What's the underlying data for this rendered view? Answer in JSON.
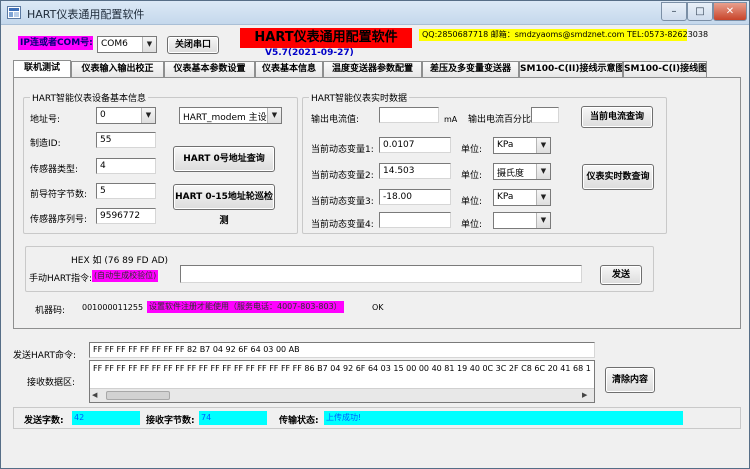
{
  "window": {
    "title": "HART仪表通用配置软件",
    "controls": [
      "–",
      "□",
      "✕"
    ]
  },
  "header": {
    "ip_com_label": "IP连或者COM号:",
    "com_port": "COM6",
    "close_port_button": "关闭串口",
    "app_title": "HART仪表通用配置软件",
    "version": "V5.7(2021-09-27)",
    "contact": "QQ:2850687718  邮箱：smdzyaoms@smdznet.com TEL:0573-82623038"
  },
  "tabs": [
    {
      "label": "联机测试",
      "active": true
    },
    {
      "label": "仪表输入输出校正",
      "active": false
    },
    {
      "label": "仪表基本参数设置",
      "active": false
    },
    {
      "label": "仪表基本信息",
      "active": false
    },
    {
      "label": "温度变送器参数配置",
      "active": false
    },
    {
      "label": "差压及多变量变送器",
      "active": false
    },
    {
      "label": "SM100-C(II)接线示意图",
      "active": false
    },
    {
      "label": "SM100-C(I)接线图)",
      "active": false
    }
  ],
  "device_info": {
    "group_title": "HART智能仪表设备基本信息",
    "address_label": "地址号:",
    "address_value": "0",
    "modem_select": "HART_modem 主设备Ⅱ",
    "manufacturer_label": "制造ID:",
    "manufacturer_value": "55",
    "sensor_type_label": "传感器类型:",
    "sensor_type_value": "4",
    "preamble_label": "前导符字节数:",
    "preamble_value": "5",
    "serial_label": "传感器序列号:",
    "serial_value": "9596772",
    "query_addr0_button": "HART 0号地址查询",
    "poll_button": "HART 0-15地址轮巡检测"
  },
  "realtime": {
    "group_title": "HART智能仪表实时数据",
    "current_label": "输出电流值:",
    "current_value": "",
    "current_unit": "mA",
    "percent_label": "输出电流百分比:",
    "percent_value": "",
    "query_current_button": "当前电流查询",
    "query_realtime_button": "仪表实时数查询",
    "unit_label": "单位:",
    "variables": [
      {
        "label": "当前动态变量1:",
        "value": "0.0107",
        "unit": "KPa"
      },
      {
        "label": "当前动态变量2:",
        "value": "14.503",
        "unit": "摄氏度"
      },
      {
        "label": "当前动态变量3:",
        "value": "-18.00",
        "unit": "KPa"
      },
      {
        "label": "当前动态变量4:",
        "value": "",
        "unit": ""
      }
    ]
  },
  "manual": {
    "hex_hint": "HEX 如 (76 89 FD AD)",
    "command_label": "手动HART指令:",
    "auto_checksum": "(自动生成校验位)",
    "command_value": "",
    "send_button": "发送"
  },
  "machine": {
    "label": "机器码:",
    "code": "001000011255",
    "register_note": "设置软件注册才能使用（服务电话：4007-803-803）",
    "ok": "OK"
  },
  "comm": {
    "send_label": "发送HART命令:",
    "send_value": "FF FF FF FF FF FF FF FF 82 B7 04 92 6F 64 03 00 AB",
    "recv_label": "接收数据区:",
    "recv_value": "FF FF FF FF FF FF FF FF FF FF FF FF FF FF FF FF FF FF 86 B7 04 92 6F 64 03 15 00 00 40 81 19 40 0C 3C 2F C8 6C 20 41 68 10 48 0",
    "clear_button": "清除内容"
  },
  "status": {
    "send_bytes_label": "发送字数:",
    "send_bytes_value": "42",
    "recv_bytes_label": "接收字节数:",
    "recv_bytes_value": "74",
    "transfer_label": "传输状态:",
    "transfer_value": "上传成功!"
  },
  "colors": {
    "magenta": "#ff00ff",
    "yellow": "#ffff00",
    "red": "#ff0000",
    "cyan": "#00ffff",
    "version_blue": "#0000c8"
  }
}
